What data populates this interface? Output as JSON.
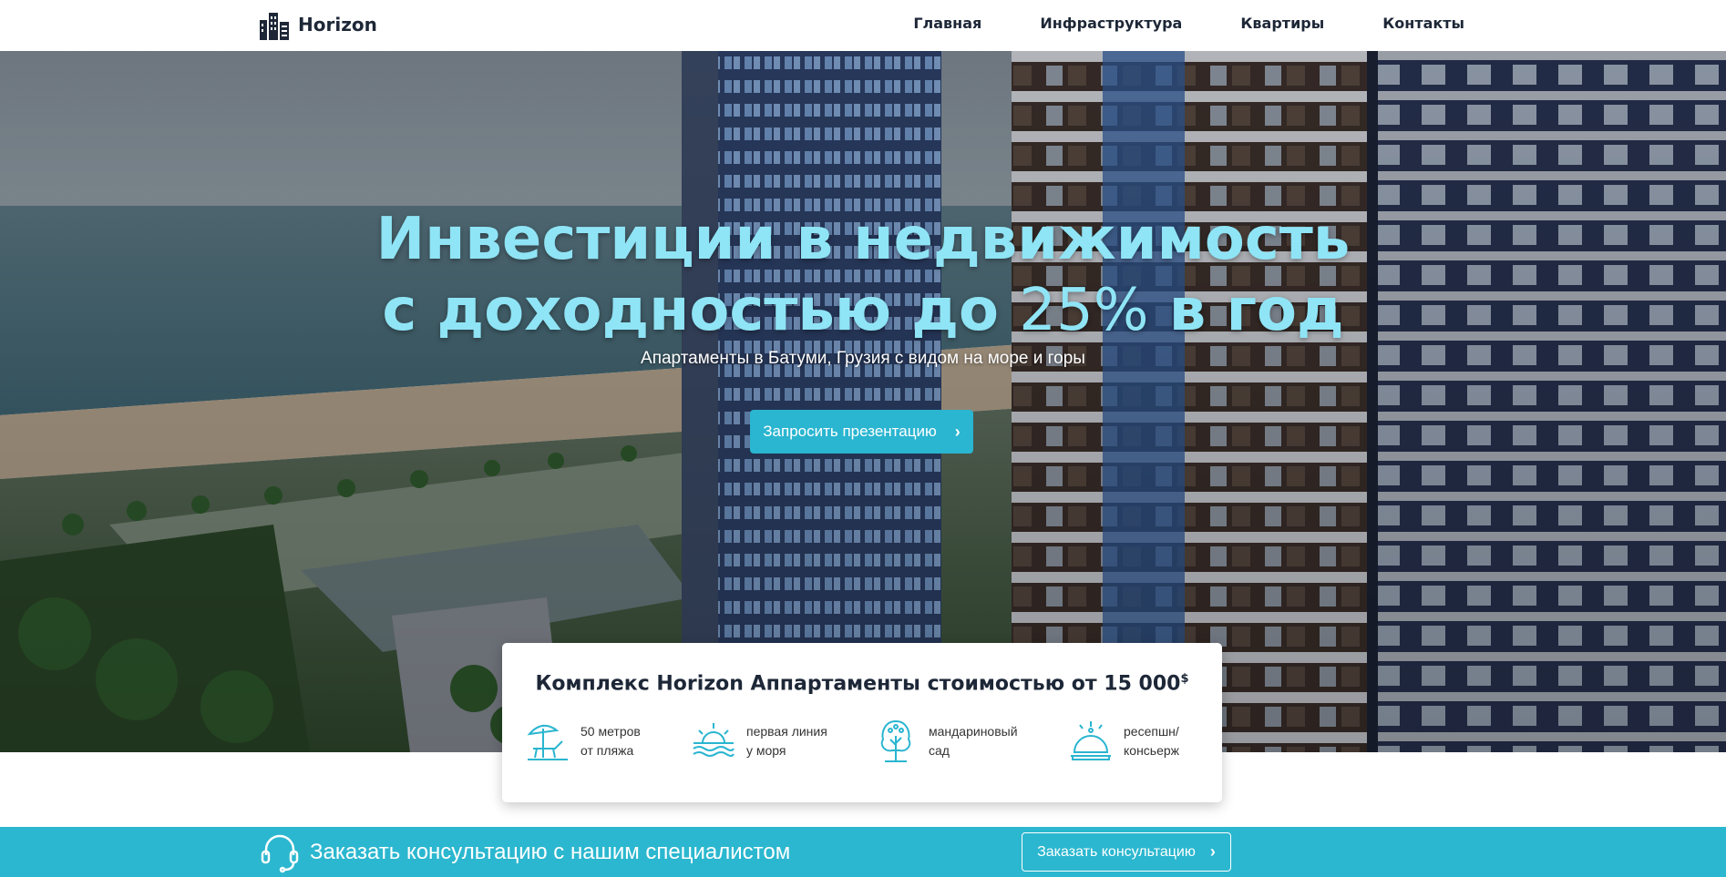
{
  "header": {
    "brand": "Horizon",
    "nav": [
      "Главная",
      "Инфраструктура",
      "Квартиры",
      "Контакты"
    ]
  },
  "hero": {
    "title_line1": "Инвестиции в недвижимость",
    "title_line2_pre": "с доходностью до ",
    "title_line2_pct": "25%",
    "title_line2_post": " в год",
    "subtitle": "Апартаменты в Батуми, Грузия с видом на море и горы",
    "cta_label": "Запросить презентацию"
  },
  "features_card": {
    "title": "Комплекс Horizon Аппартаменты стоимостью от 15 000",
    "currency": "$",
    "items": [
      {
        "icon": "beach-umbrella-icon",
        "line1": "50 метров",
        "line2": "от пляжа"
      },
      {
        "icon": "sunset-sea-icon",
        "line1": "первая линия",
        "line2": "у моря"
      },
      {
        "icon": "tree-icon",
        "line1": "мандариновый",
        "line2": "сад"
      },
      {
        "icon": "reception-bell-icon",
        "line1": "ресепшн/",
        "line2": "консьерж"
      }
    ]
  },
  "consultation": {
    "text": "Заказать консультацию с нашим специалистом",
    "button_label": "Заказать консультацию"
  },
  "colors": {
    "accent": "#2ab5d0",
    "title_cyan": "#8fe4f5",
    "dark_text": "#1d2737"
  }
}
